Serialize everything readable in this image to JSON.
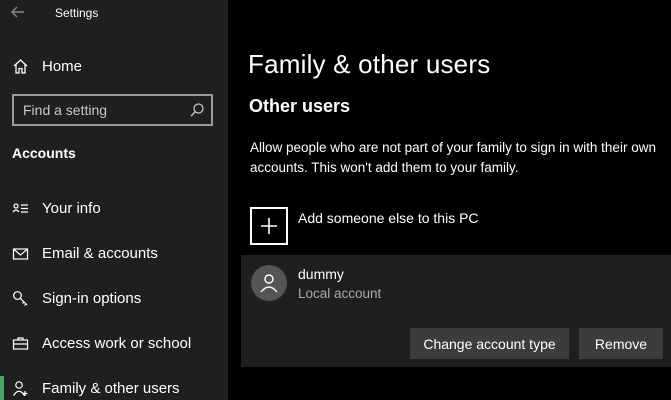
{
  "window": {
    "title": "Settings"
  },
  "sidebar": {
    "home_label": "Home",
    "search_placeholder": "Find a setting",
    "section_header": "Accounts",
    "items": [
      {
        "label": "Your info",
        "icon": "contact-card-icon"
      },
      {
        "label": "Email & accounts",
        "icon": "mail-icon"
      },
      {
        "label": "Sign-in options",
        "icon": "key-icon"
      },
      {
        "label": "Access work or school",
        "icon": "briefcase-icon"
      },
      {
        "label": "Family & other users",
        "icon": "person-add-icon",
        "selected": true
      }
    ],
    "accent_color": "#4aa564"
  },
  "main": {
    "title": "Family & other users",
    "subtitle": "Other users",
    "description": "Allow people who are not part of your family to sign in with their own accounts. This won't add them to your family.",
    "add_label": "Add someone else to this PC",
    "account": {
      "name": "dummy",
      "type": "Local account",
      "change_button": "Change account type",
      "remove_button": "Remove"
    }
  }
}
